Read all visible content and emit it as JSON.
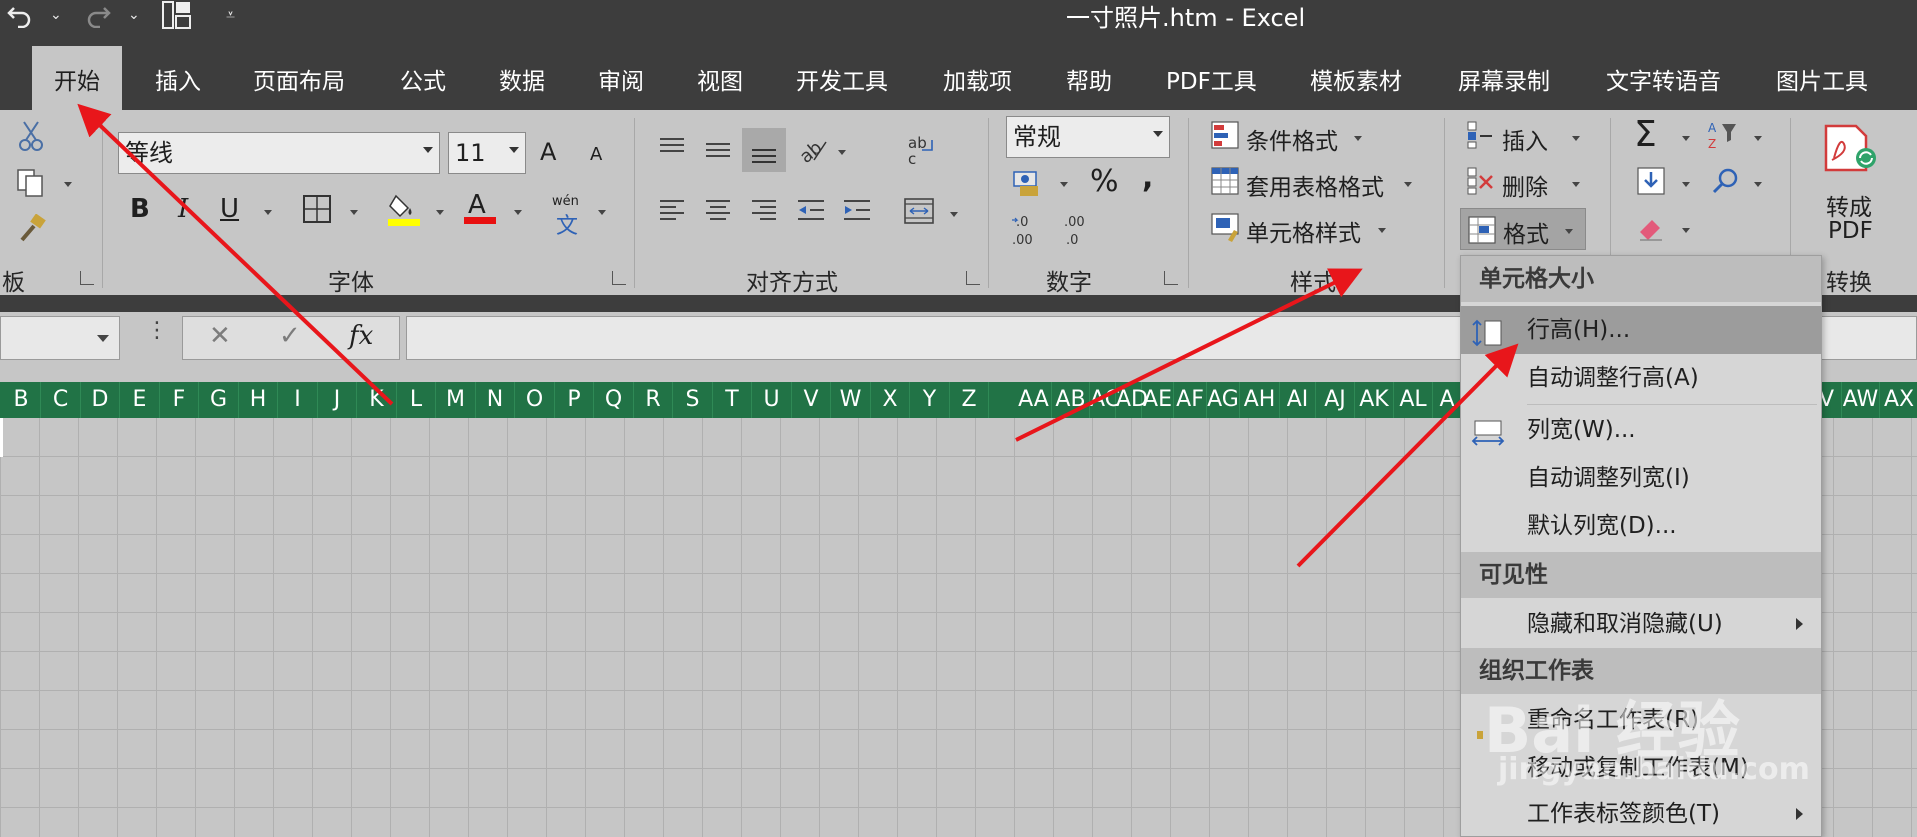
{
  "window": {
    "title": "一寸照片.htm  -  Excel"
  },
  "tabs": [
    "开始",
    "插入",
    "页面布局",
    "公式",
    "数据",
    "审阅",
    "视图",
    "开发工具",
    "加载项",
    "帮助",
    "PDF工具",
    "模板素材",
    "屏幕录制",
    "文字转语音",
    "图片工具"
  ],
  "ribbon": {
    "clipboard": {
      "label": "板"
    },
    "font": {
      "label": "字体",
      "name": "等线",
      "size": "11",
      "bold": "B",
      "italic": "I",
      "underline": "U",
      "grow": "A",
      "shrink": "A",
      "font_color_glyph": "A",
      "phonetic_top": "wén",
      "phonetic_bottom": "文"
    },
    "align": {
      "label": "对齐方式",
      "wrap": "ab\nc"
    },
    "number": {
      "label": "数字",
      "format": "常规",
      "percent": "%",
      "comma": ","
    },
    "styles": {
      "label": "样式",
      "conditional": "条件格式",
      "table": "套用表格格式",
      "cell": "单元格样式"
    },
    "cells": {
      "insert": "插入",
      "delete": "删除",
      "format": "格式"
    },
    "editing": {
      "sum": "Σ"
    },
    "convert": {
      "label": "转换",
      "btn_line1": "转成",
      "btn_line2": "PDF"
    }
  },
  "formula_bar": {
    "fx": "fx",
    "cancel": "✕",
    "enter": "✓"
  },
  "columns": [
    "B",
    "C",
    "D",
    "E",
    "F",
    "G",
    "H",
    "I",
    "J",
    "K",
    "L",
    "M",
    "N",
    "O",
    "P",
    "Q",
    "R",
    "S",
    "T",
    "U",
    "V",
    "W",
    "X",
    "Y",
    "Z",
    "AA",
    "AB",
    "AC",
    "AD",
    "AE",
    "AF",
    "AG",
    "AH",
    "AI",
    "AJ",
    "AK",
    "AL",
    "A",
    "V",
    "AW",
    "AX"
  ],
  "context_menu": {
    "section_size": "单元格大小",
    "row_height": "行高(H)...",
    "autofit_row": "自动调整行高(A)",
    "col_width": "列宽(W)...",
    "autofit_col": "自动调整列宽(I)",
    "default_width": "默认列宽(D)...",
    "section_visibility": "可见性",
    "hide_unhide": "隐藏和取消隐藏(U)",
    "section_organize": "组织工作表",
    "rename": "重命名工作表(R)",
    "move_copy": "移动或复制工作表(M)",
    "tab_color": "工作表标签颜色(T)"
  },
  "watermark": {
    "line1": "Bai 经验",
    "line2": "jingyan.baidu.com"
  },
  "colors": {
    "header_green": "#217346",
    "arrow_red": "#e8161b",
    "dark": "#3d3d3d"
  }
}
